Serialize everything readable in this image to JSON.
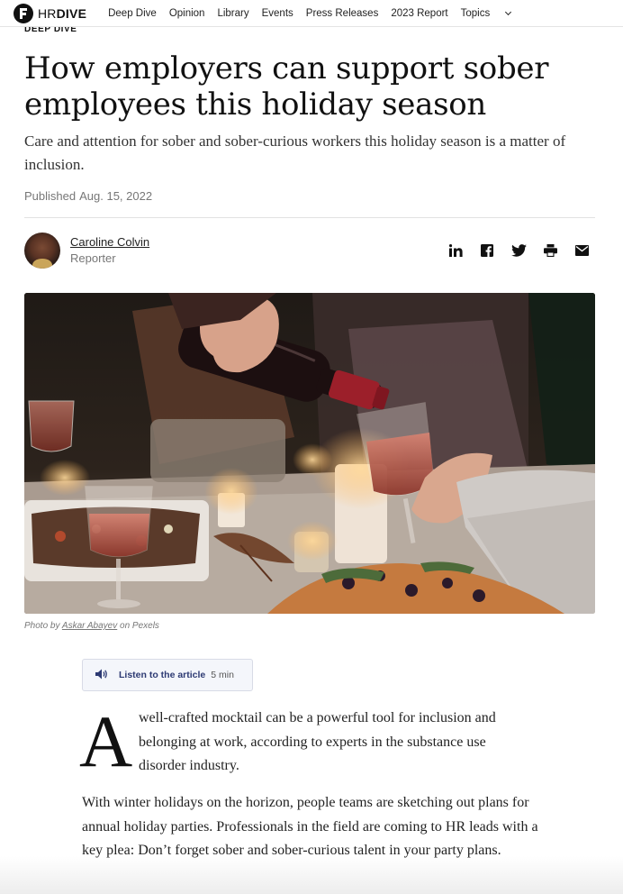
{
  "brand": {
    "light": "HR",
    "bold": "DIVE"
  },
  "nav": {
    "items": [
      "Deep Dive",
      "Opinion",
      "Library",
      "Events",
      "Press Releases",
      "2023 Report"
    ],
    "topics": "Topics"
  },
  "article": {
    "section": "DEEP DIVE",
    "headline": "How employers can support sober employees this holiday season",
    "dek": "Care and attention for sober and sober-curious workers this holiday season is a matter of inclusion.",
    "published_label": "Published",
    "published_date": "Aug. 15, 2022",
    "author": {
      "name": "Caroline Colvin",
      "role": "Reporter"
    },
    "share_icons": [
      "linkedin-icon",
      "facebook-icon",
      "twitter-icon",
      "print-icon",
      "email-icon"
    ],
    "photo": {
      "prefix": "Photo by",
      "credit": "Askar Abayev",
      "suffix": "on Pexels"
    },
    "listen": {
      "label": "Listen to the article",
      "duration": "5 min"
    },
    "dropcap": "A",
    "lead_text": "well-crafted mocktail can be a powerful tool for inclusion and belonging at work, according to experts in the substance use disorder industry.",
    "paragraph_2": "With winter holidays on the horizon, people teams are sketching out plans for annual holiday parties. Professionals in the field are coming to HR leads with a key plea: Don’t forget sober and sober-curious talent in your party plans."
  },
  "colors": {
    "accent": "#2d3a73",
    "text": "#111111",
    "muted": "#777777"
  }
}
